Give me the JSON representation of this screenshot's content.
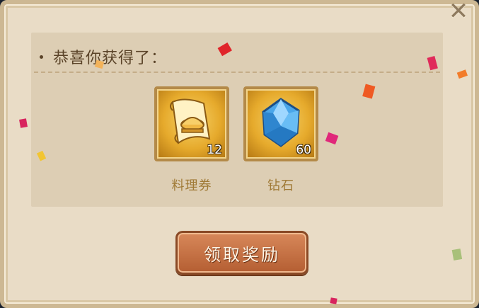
{
  "dialog": {
    "title": "恭喜你获得了：",
    "close_icon": "close-icon",
    "claim_label": "领取奖励"
  },
  "rewards": [
    {
      "name": "料理券",
      "count": "12",
      "icon": "food-coupon-scroll-icon"
    },
    {
      "name": "钻石",
      "count": "60",
      "icon": "diamond-gem-icon"
    }
  ],
  "colors": {
    "parchment": "#e9dcc6",
    "panel": "#ddceb4",
    "title_text": "#5a4328",
    "item_name": "#a07a36",
    "button": "#c97144"
  }
}
